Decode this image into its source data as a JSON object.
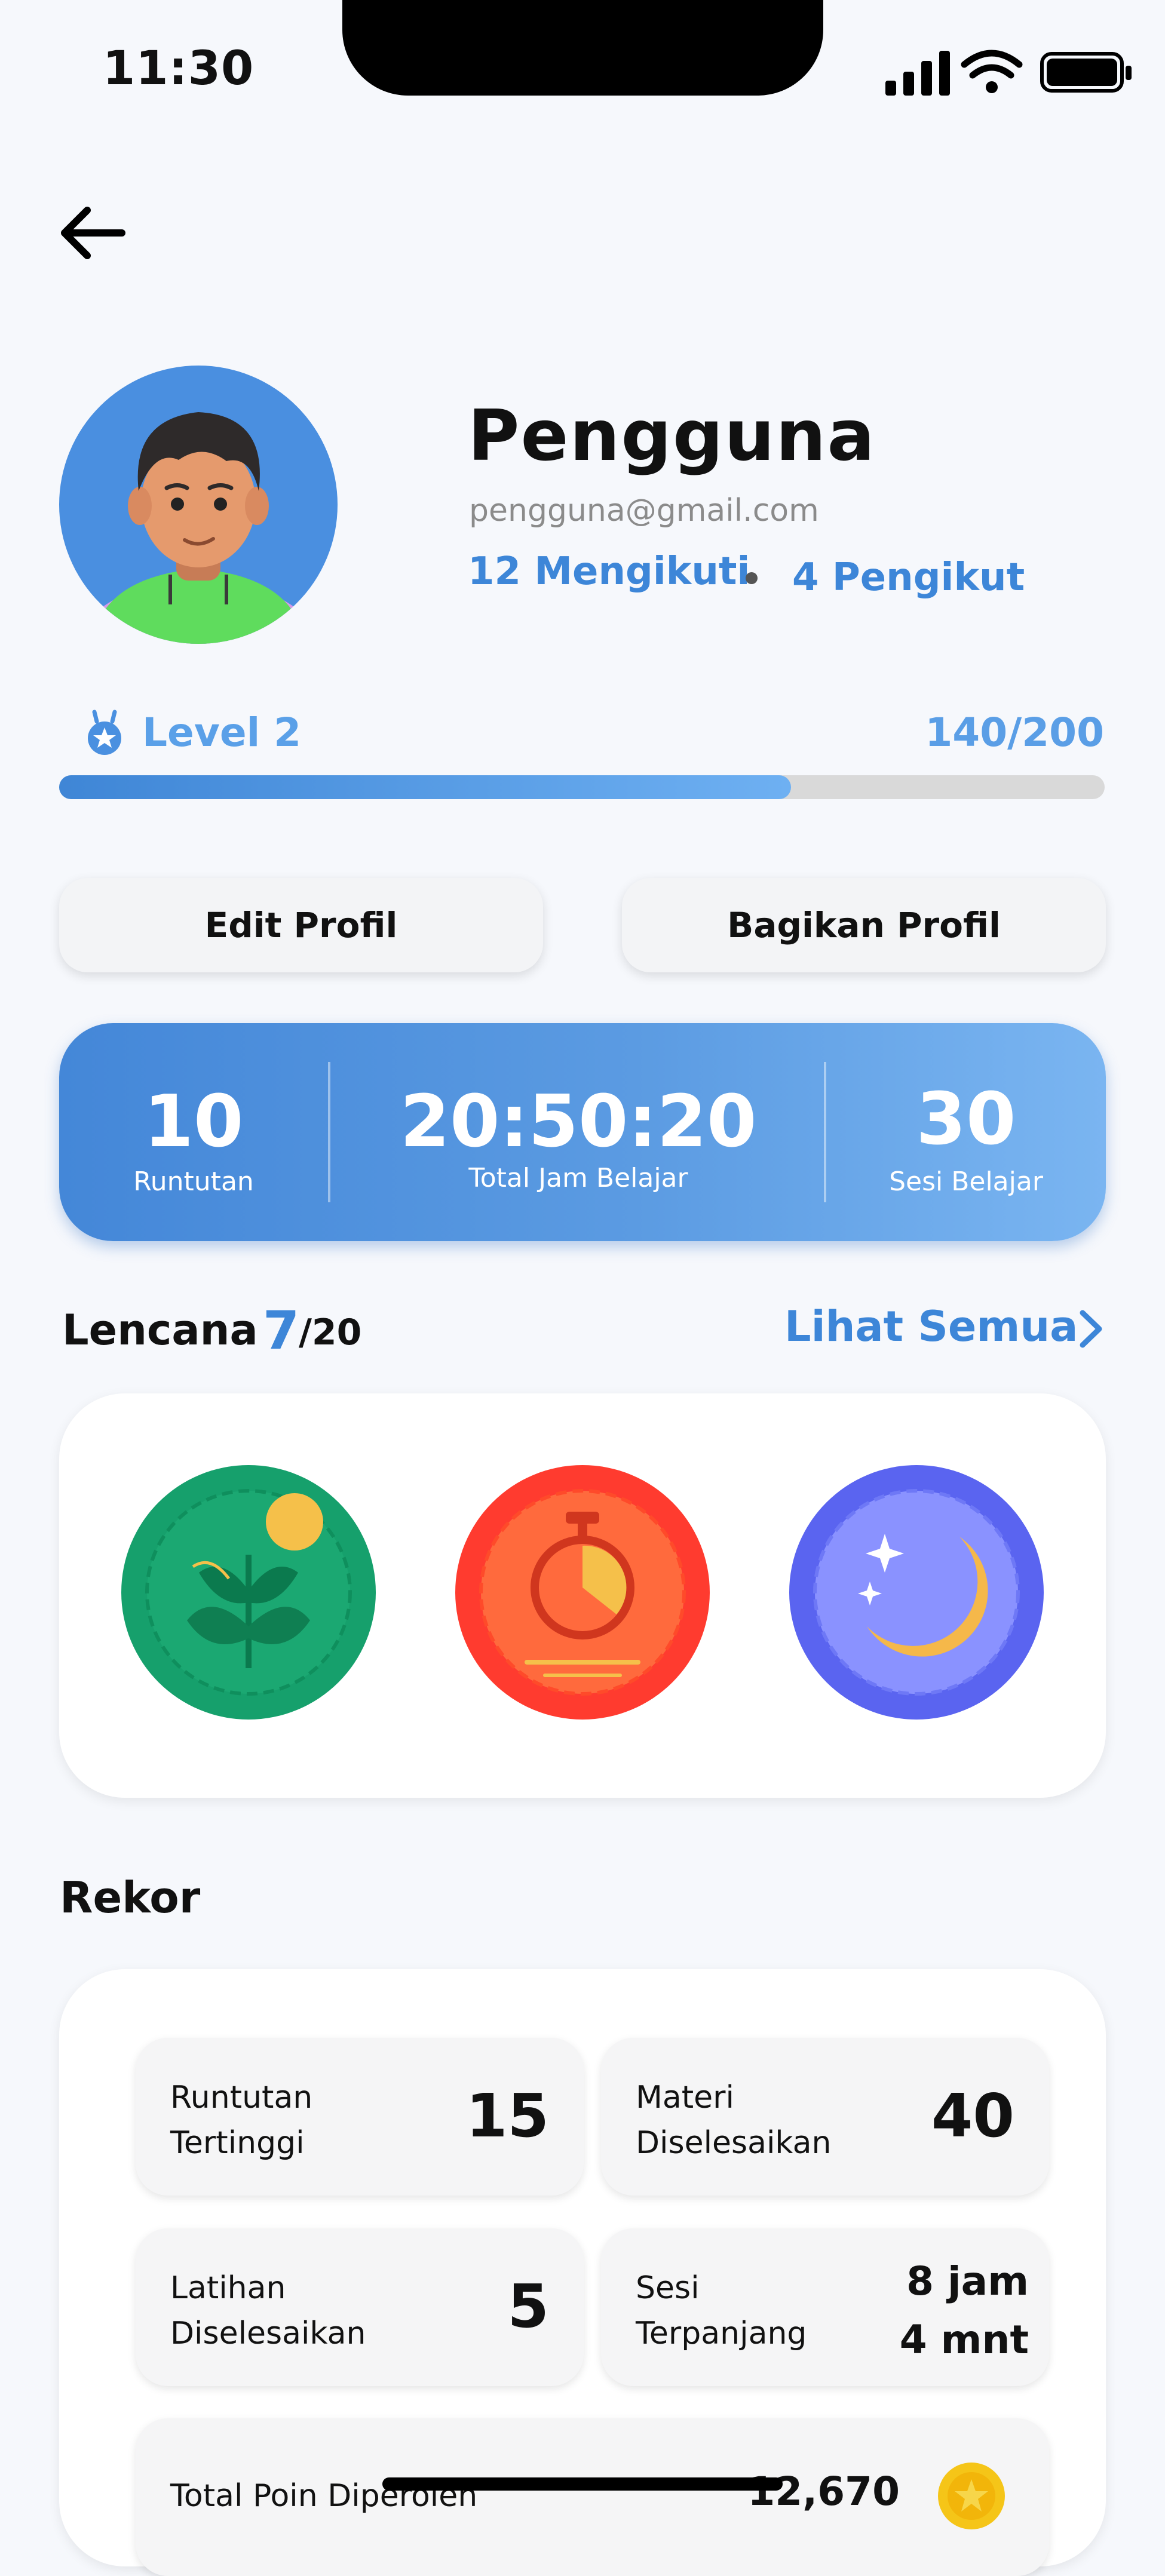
{
  "status_bar": {
    "time": "11:30"
  },
  "profile": {
    "name": "Pengguna",
    "email": "pengguna@gmail.com",
    "following": "12 Mengikuti",
    "followers": "4 Pengikut"
  },
  "level": {
    "label": "Level 2",
    "points": "140/200",
    "progress": 0.7
  },
  "buttons": {
    "edit": "Edit Profil",
    "share": "Bagikan Profil"
  },
  "stats": {
    "streak": {
      "value": "10",
      "label": "Runtutan"
    },
    "hours": {
      "value": "20:50:20",
      "label": "Total Jam Belajar"
    },
    "sessions": {
      "value": "30",
      "label": "Sesi Belajar"
    }
  },
  "badges": {
    "title": "Lencana",
    "count": "7",
    "total": "/20",
    "see_all": "Lihat Semua",
    "items": [
      {
        "icon": "plant-badge-icon",
        "color": "#16a06c"
      },
      {
        "icon": "stopwatch-badge-icon",
        "color": "#ff3b2f"
      },
      {
        "icon": "moon-badge-icon",
        "color": "#5a64f0"
      }
    ]
  },
  "records": {
    "title": "Rekor",
    "items": [
      {
        "label": "Runtutan\nTertinggi",
        "value": "15"
      },
      {
        "label": "Materi\nDiselesaikan",
        "value": "40"
      },
      {
        "label": "Latihan\nDiselesaikan",
        "value": "5"
      },
      {
        "label": "Sesi\nTerpanjang",
        "value1": "8 jam",
        "value2": "4 mnt"
      },
      {
        "label": "Total Poin Diperoleh",
        "value": "12,670"
      }
    ]
  },
  "colors": {
    "accent": "#3d86d8",
    "background": "#f6f8fc"
  }
}
